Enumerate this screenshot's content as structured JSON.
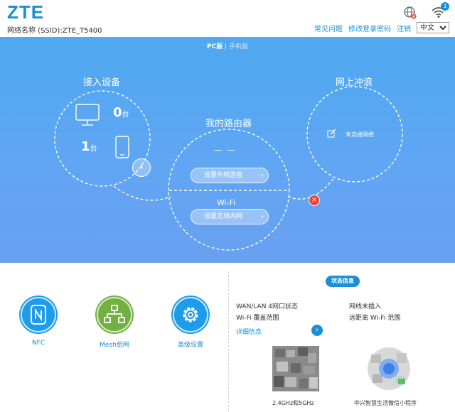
{
  "header": {
    "logo": "ZTE",
    "ssid_label": "网络名称 (SSID):ZTE_T5400",
    "links": [
      "常见问题",
      "修改登录密码",
      "注销"
    ],
    "language": "中文",
    "language_options": [
      "中文"
    ],
    "wifi_badge": "1",
    "icons": [
      "globe-icon",
      "wifi-icon"
    ]
  },
  "banner": {
    "view_pc": "PC版",
    "view_sep": " | ",
    "view_mobile": "手机版",
    "devices": {
      "title": "接入设备",
      "wired_count": "0",
      "wireless_count": "1",
      "unit": "台"
    },
    "router": {
      "title": "我的路由器",
      "wan_value": "— —",
      "wan_button": "设置外网连接",
      "wifi_label": "Wi-Fi",
      "wifi_button": "设置无线内网"
    },
    "internet": {
      "title": "网上冲浪",
      "status": "未连接网络"
    }
  },
  "features": [
    {
      "label": "NFC",
      "icon": "nfc-icon",
      "color": "#1e9be9"
    },
    {
      "label": "Mesh组网",
      "icon": "mesh-icon",
      "color": "#72b043"
    },
    {
      "label": "高级设置",
      "icon": "gear-icon",
      "color": "#1e9be9"
    }
  ],
  "status": {
    "badge": "状态信息",
    "wan_lan": "WAN/LAN 4网口状态",
    "wan_state": "网线未插入",
    "coverage": "Wi-Fi 覆盖范围",
    "coverage_state": "远距离 Wi-Fi 范围",
    "detail": "详细信息"
  },
  "qr": {
    "left_caption": "2.4GHz和5GHz",
    "right_caption": "中兴智慧生活微信小程序"
  },
  "colors": {
    "accent": "#1a8fd6",
    "banner": "#5fa6f3",
    "error": "#e8453c",
    "mesh_green": "#72b043"
  }
}
